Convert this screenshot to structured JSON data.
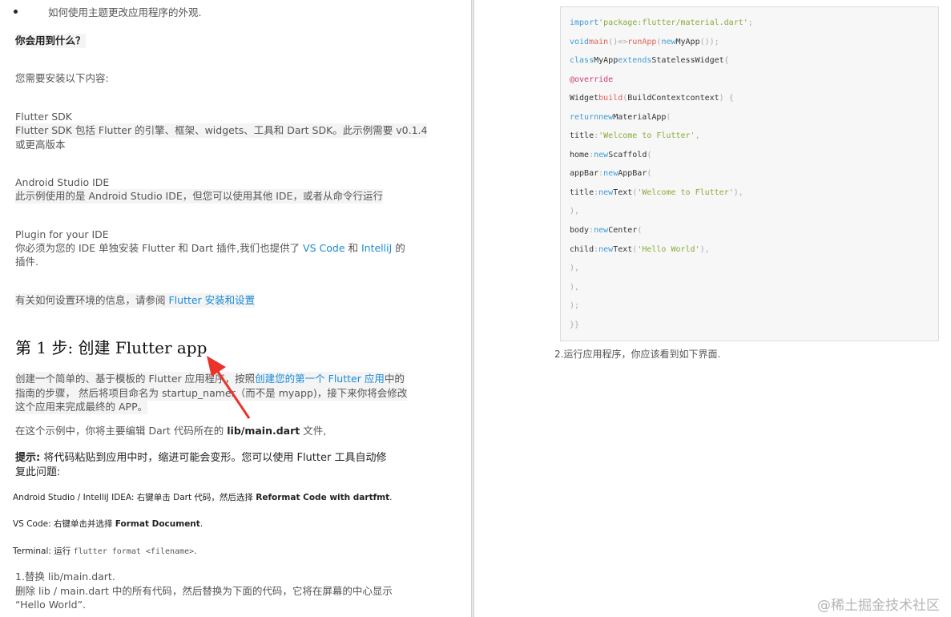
{
  "left": {
    "bullet": "如何使用主题更改应用程序的外观.",
    "what_heading": "你会用到什么？",
    "install_intro": "您需要安装以下内容:",
    "sdk_title": "Flutter SDK",
    "sdk_desc_1": "Flutter SDK 包括 Flutter 的引擎、框架、widgets、工具和 Dart SDK。此示例需要 v0.1.4",
    "sdk_desc_2": "或更高版本",
    "studio_title": "Android Studio IDE",
    "studio_desc": "此示例使用的是 Android Studio IDE，但您可以使用其他 IDE，或者从命令行运行",
    "plugin_title": "Plugin for your IDE",
    "plugin_desc_a": "你必须为您的 IDE 单独安装 Flutter  和  Dart 插件,我们也提供了 ",
    "plugin_link_vscode": "VS Code",
    "plugin_desc_b": " 和 ",
    "plugin_link_intellij": "IntelliJ",
    "plugin_desc_c": " 的",
    "plugin_desc_2": "插件.",
    "env_info_a": "有关如何设置环境的信息，请参阅 ",
    "env_info_link": "Flutter  安装和设置",
    "step_heading": "第 1 步: 创建 Flutter app",
    "create_a": "创建一个简单的、基于模板的 Flutter 应用程序，按照",
    "create_link": "创建您的第一个 Flutter 应用",
    "create_b": "中的",
    "create_2": "指南的步骤，  然后将项目命名为 startup_namer（而不是 myapp)，接下来你将会修改",
    "create_3": "这个应用来完成最终的 APP。",
    "edit_a": "在这个示例中，你将主要编辑 Dart 代码所在的 ",
    "edit_file": "lib/main.dart",
    "edit_b": " 文件,",
    "tip_label": "提示:",
    "tip_1": " 将代码粘贴到应用中时，缩进可能会变形。您可以使用 Flutter 工具自动修",
    "tip_2": "复此问题:",
    "as_label": "Android Studio / IntelliJ IDEA:  右键单击 Dart 代码，然后选择 ",
    "as_action": "Reformat Code with dartfmt",
    "as_end": ".",
    "vs_label": "VS Code:  右键单击并选择 ",
    "vs_action": "Format Document",
    "vs_end": ".",
    "term_label": "Terminal:  运行 ",
    "term_cmd": "flutter format <filename>",
    "term_end": ".",
    "replace_1": "1.替换  lib/main.dart.",
    "replace_2": "删除 lib / main.dart 中的所有代码，然后替换为下面的代码，它将在屏幕的中心显示",
    "replace_3": "“Hello World”."
  },
  "code": {
    "l1a": "import",
    "l1b": "'package:flutter/material.dart'",
    "l1c": ";",
    "l2a": "void",
    "l2b": "main",
    "l2c": "()=>",
    "l2d": "runApp",
    "l2e": "(",
    "l2f": "new",
    "l2g": "MyApp",
    "l2h": "());",
    "l3a": "class",
    "l3b": "MyApp",
    "l3c": "extends",
    "l3d": "StatelessWidget",
    "l3e": "{",
    "l4": "@override",
    "l5a": "Widget",
    "l5b": "build",
    "l5c": "(",
    "l5d": "BuildContextcontext",
    "l5e": ") {",
    "l6a": "return",
    "l6b": "new",
    "l6c": "MaterialApp",
    "l6d": "(",
    "l7a": "title",
    "l7b": ":",
    "l7c": "'Welcome to Flutter'",
    "l7d": ",",
    "l8a": "home",
    "l8b": ":",
    "l8c": "new",
    "l8d": "Scaffold",
    "l8e": "(",
    "l9a": "appBar",
    "l9b": ":",
    "l9c": "new",
    "l9d": "AppBar",
    "l9e": "(",
    "l10a": "title",
    "l10b": ":",
    "l10c": "new",
    "l10d": "Text",
    "l10e": "(",
    "l10f": "'Welcome to Flutter'",
    "l10g": "),",
    "l11": "),",
    "l12a": "body",
    "l12b": ":",
    "l12c": "new",
    "l12d": "Center",
    "l12e": "(",
    "l13a": "child",
    "l13b": ":",
    "l13c": "new",
    "l13d": "Text",
    "l13e": "(",
    "l13f": "'Hello World'",
    "l13g": "),",
    "l14": "),",
    "l15": "),",
    "l16": ");",
    "l17": "}}"
  },
  "right": {
    "caption": "2.运行应用程序，你应该看到如下界面."
  },
  "watermark": "@稀土掘金技术社区",
  "colors": {
    "link": "#1a8bd6",
    "keyword": "#3f9ad6",
    "string": "#8aaa3c",
    "function": "#e0605a",
    "annotation": "#c83a7a",
    "arrow": "#e8342a"
  },
  "icons": {
    "annotation_arrow": "red-arrow-icon"
  }
}
